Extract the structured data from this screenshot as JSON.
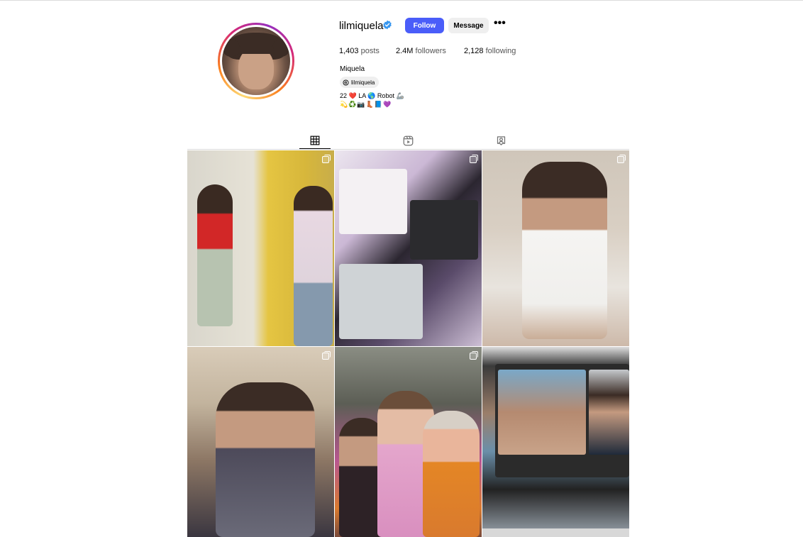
{
  "profile": {
    "username": "lilmiquela",
    "verified": true,
    "follow_label": "Follow",
    "message_label": "Message",
    "more_label": "•••",
    "stats": {
      "posts_count": "1,403",
      "posts_label": "posts",
      "followers_count": "2.4M",
      "followers_label": "followers",
      "following_count": "2,128",
      "following_label": "following"
    },
    "full_name": "Miquela",
    "threads_handle": "lilmiquela",
    "bio_line1": "22 ❤️ LA 🌎 Robot 🦾",
    "bio_line2": "💫♻️📷👢📘💜"
  },
  "tabs": [
    {
      "name": "posts",
      "icon": "grid-icon",
      "active": true
    },
    {
      "name": "reels",
      "icon": "reels-icon",
      "active": false
    },
    {
      "name": "tagged",
      "icon": "tagged-icon",
      "active": false
    }
  ],
  "grid": {
    "posts": [
      {
        "multi": true
      },
      {
        "multi": true
      },
      {
        "multi": true
      },
      {
        "multi": true
      },
      {
        "multi": true
      },
      {
        "multi": false
      }
    ]
  },
  "colors": {
    "follow_button": "#4a5df9",
    "verified": "#3897f0",
    "secondary_button": "#efefef"
  }
}
